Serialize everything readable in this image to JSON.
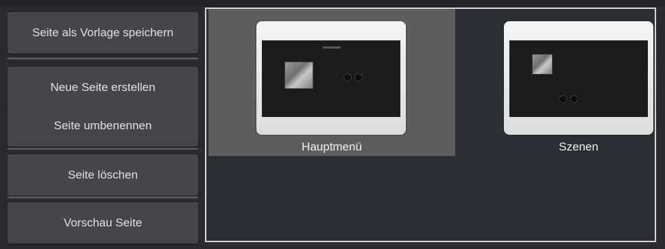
{
  "actions": {
    "save_template": "Seite als Vorlage speichern",
    "new_page": "Neue Seite erstellen",
    "rename_page": "Seite umbenennen",
    "delete_page": "Seite löschen",
    "preview_page": "Vorschau Seite"
  },
  "pages": [
    {
      "label": "Hauptmenü",
      "selected": true
    },
    {
      "label": "Szenen",
      "selected": false
    }
  ],
  "colors": {
    "background": "#2b2c30",
    "button": "#45464c",
    "selected_tile": "#5e5e5f",
    "panel_border": "#d8d8d8"
  }
}
